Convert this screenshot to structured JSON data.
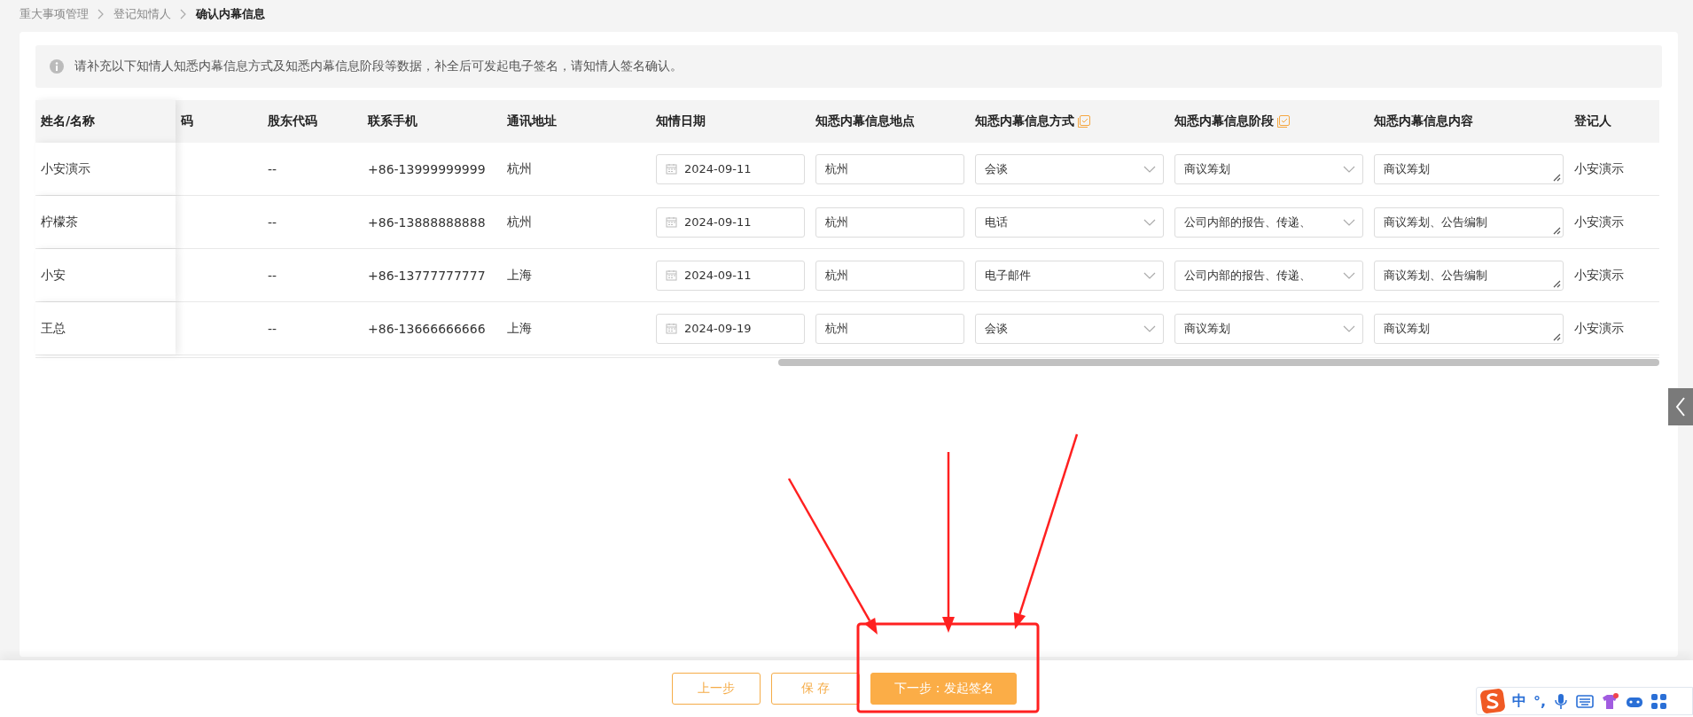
{
  "breadcrumb": [
    {
      "label": "重大事项管理",
      "current": false
    },
    {
      "label": "登记知情人",
      "current": false
    },
    {
      "label": "确认内幕信息",
      "current": true
    }
  ],
  "notice": {
    "text": "请补充以下知情人知悉内幕信息方式及知悉内幕信息阶段等数据，补全后可发起电子签名，请知情人签名确认。"
  },
  "table": {
    "columns": [
      {
        "label": "姓名/名称",
        "kind": "plain"
      },
      {
        "label": "码",
        "kind": "plain"
      },
      {
        "label": "股东代码",
        "kind": "plain"
      },
      {
        "label": "联系手机",
        "kind": "plain"
      },
      {
        "label": "通讯地址",
        "kind": "plain"
      },
      {
        "label": "知情日期",
        "kind": "plain"
      },
      {
        "label": "知悉内幕信息地点",
        "kind": "plain"
      },
      {
        "label": "知悉内幕信息方式",
        "kind": "editable"
      },
      {
        "label": "知悉内幕信息阶段",
        "kind": "editable"
      },
      {
        "label": "知悉内幕信息内容",
        "kind": "plain"
      },
      {
        "label": "登记人",
        "kind": "plain"
      }
    ],
    "rows": [
      {
        "name": "小安演示",
        "shareholder_code": "--",
        "phone": "+86-13999999999",
        "address": "杭州",
        "date": "2024-09-11",
        "location": "杭州",
        "method": "会谈",
        "stage": "商议筹划",
        "content": "商议筹划",
        "registrant": "小安演示"
      },
      {
        "name": "柠檬茶",
        "shareholder_code": "--",
        "phone": "+86-13888888888",
        "address": "杭州",
        "date": "2024-09-11",
        "location": "杭州",
        "method": "电话",
        "stage": "公司内部的报告、传递、",
        "content": "商议筹划、公告编制",
        "registrant": "小安演示"
      },
      {
        "name": "小安",
        "shareholder_code": "--",
        "phone": "+86-13777777777",
        "address": "上海",
        "date": "2024-09-11",
        "location": "杭州",
        "method": "电子邮件",
        "stage": "公司内部的报告、传递、",
        "content": "商议筹划、公告编制",
        "registrant": "小安演示"
      },
      {
        "name": "王总",
        "shareholder_code": "--",
        "phone": "+86-13666666666",
        "address": "上海",
        "date": "2024-09-19",
        "location": "杭州",
        "method": "会谈",
        "stage": "商议筹划",
        "content": "商议筹划",
        "registrant": "小安演示"
      }
    ]
  },
  "footer": {
    "buttons": [
      {
        "label": "上一步",
        "kind": "outline"
      },
      {
        "label": "保 存",
        "kind": "outline"
      },
      {
        "label": "下一步：发起签名",
        "kind": "primary"
      }
    ]
  },
  "ime_toolbar": {
    "items": [
      "中",
      "°,"
    ]
  },
  "annotations": [
    {
      "kind": "frame"
    },
    {
      "kind": "arrow"
    },
    {
      "kind": "arrow"
    },
    {
      "kind": "arrow"
    }
  ]
}
